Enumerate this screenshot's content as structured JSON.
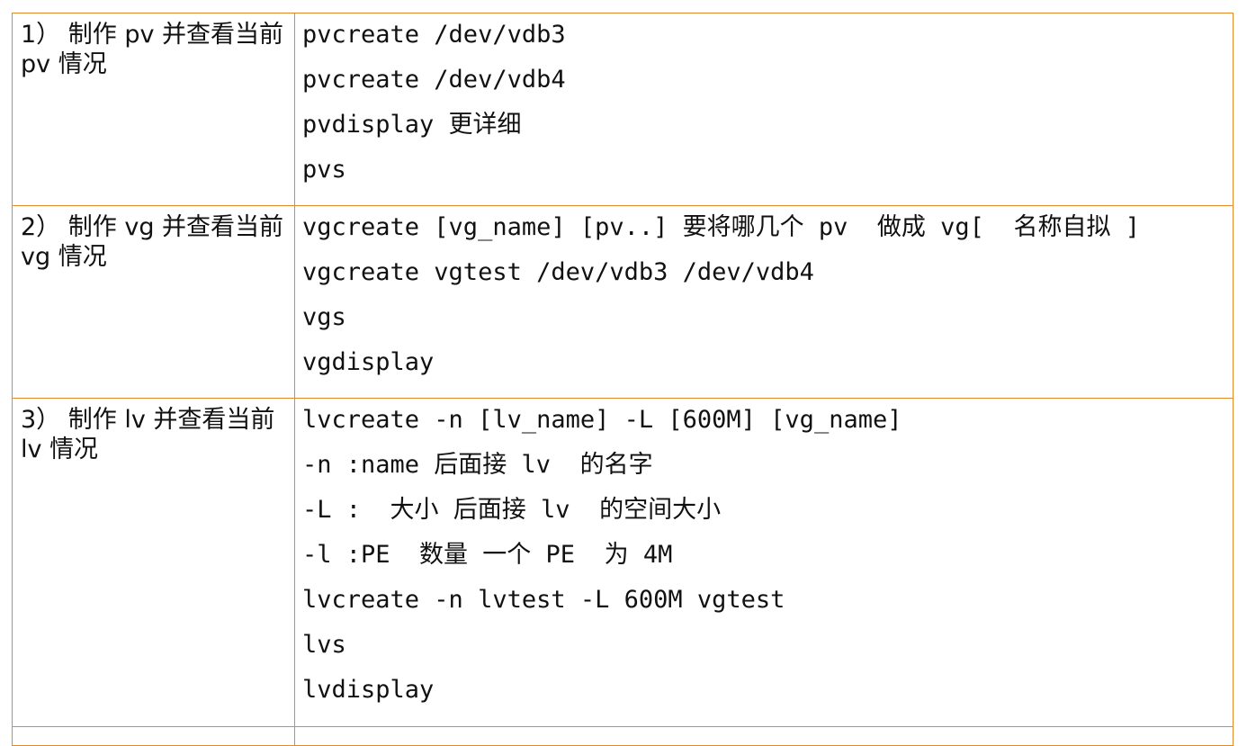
{
  "rows": [
    {
      "step": "1） 制作 pv  并查看当前 pv  情况",
      "commands": [
        "pvcreate /dev/vdb3",
        "pvcreate /dev/vdb4",
        "pvdisplay 更详细",
        "pvs"
      ]
    },
    {
      "step": "2） 制作 vg  并查看当前 vg  情况",
      "commands": [
        "vgcreate [vg_name] [pv..] 要将哪几个 pv  做成 vg[  名称自拟 ]",
        "vgcreate vgtest /dev/vdb3 /dev/vdb4",
        "vgs",
        "vgdisplay"
      ]
    },
    {
      "step": "3） 制作 lv  并查看当前 lv  情况",
      "commands": [
        "lvcreate -n [lv_name] -L [600M] [vg_name]",
        "-n :name 后面接 lv  的名字",
        "-L :  大小 后面接 lv  的空间大小",
        "-l :PE  数量 一个 PE  为 4M",
        "lvcreate -n lvtest -L 600M vgtest",
        "lvs",
        "lvdisplay"
      ]
    }
  ]
}
